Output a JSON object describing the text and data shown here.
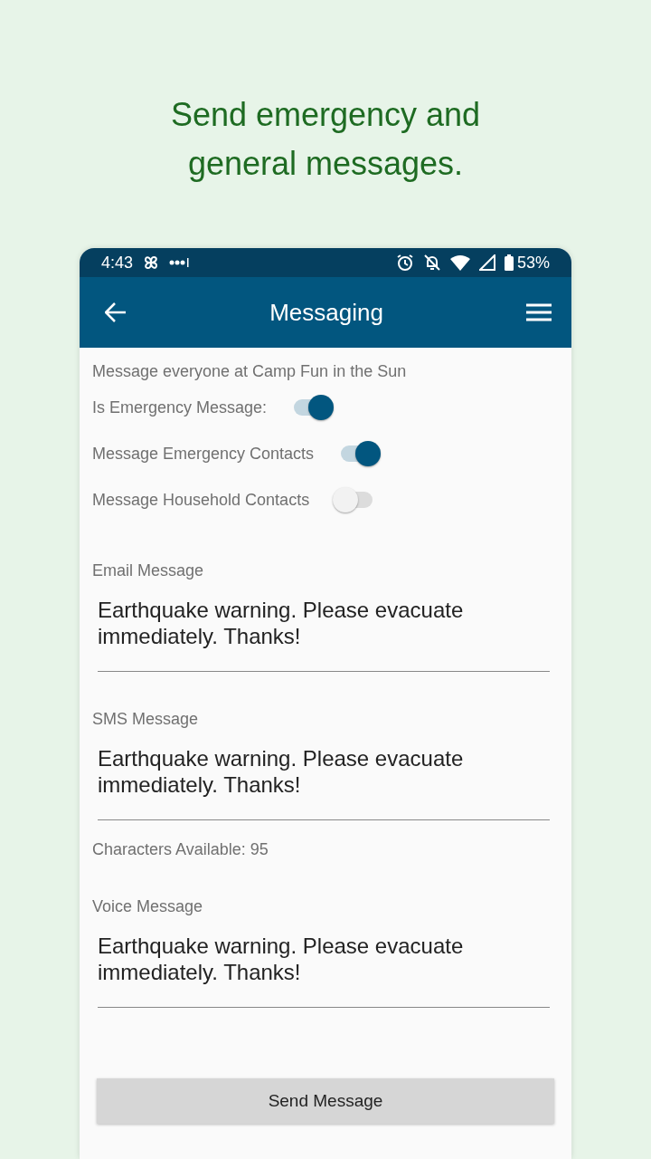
{
  "headline": "Send emergency and general messages.",
  "status_bar": {
    "time": "4:43",
    "battery": "53%"
  },
  "app_bar": {
    "title": "Messaging"
  },
  "subtitle": "Message everyone at Camp Fun in the Sun",
  "toggles": [
    {
      "label": "Is Emergency Message:",
      "on": true
    },
    {
      "label": "Message Emergency Contacts",
      "on": true
    },
    {
      "label": "Message Household Contacts",
      "on": false
    }
  ],
  "fields": [
    {
      "kind": "message",
      "label": "Email Message",
      "value": "Earthquake warning. Please evacuate immediately. Thanks!"
    },
    {
      "kind": "message",
      "label": "SMS Message",
      "value": "Earthquake warning. Please evacuate immediately. Thanks!"
    },
    {
      "kind": "note",
      "label": "Characters Available: 95"
    },
    {
      "kind": "message",
      "label": "Voice Message",
      "value": "Earthquake warning. Please evacuate immediately. Thanks!"
    }
  ],
  "send_button": "Send Message"
}
